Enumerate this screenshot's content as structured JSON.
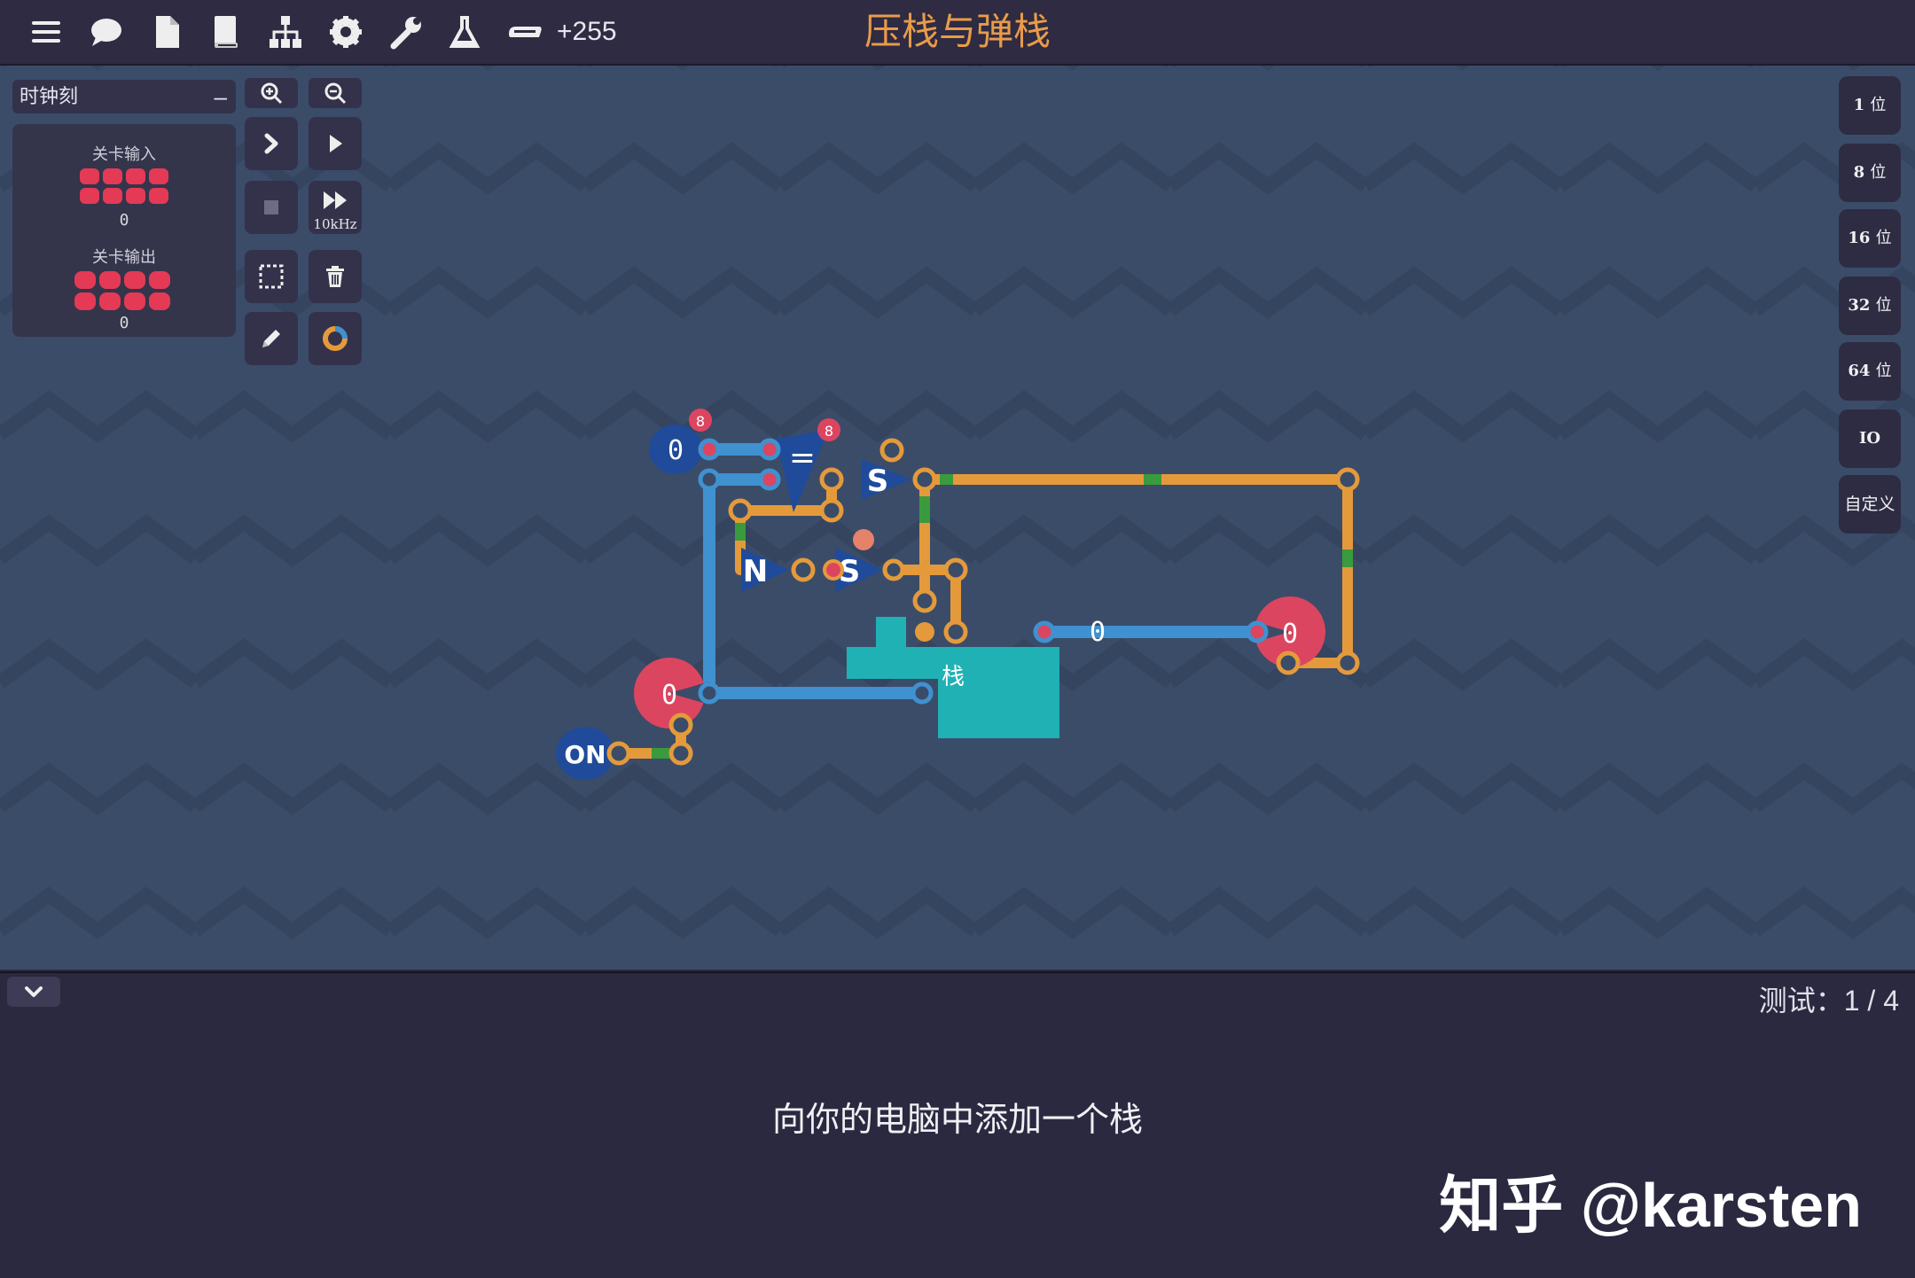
{
  "toolbar": {
    "icons": [
      "menu-icon",
      "chat-icon",
      "document-icon",
      "book-icon",
      "hierarchy-icon",
      "gear-icon",
      "wrench-icon",
      "flask-icon",
      "scanner-icon"
    ],
    "credits": "+255"
  },
  "title": "压栈与弹栈",
  "left_panel": {
    "clock_select": {
      "value": "时钟刻",
      "collapse": "–"
    },
    "level_input": {
      "label": "关卡输入",
      "value": "0"
    },
    "level_output": {
      "label": "关卡输出",
      "value": "0"
    },
    "frequency": "10kHz"
  },
  "bit_buttons": [
    {
      "num": "1",
      "unit": "位"
    },
    {
      "num": "8",
      "unit": "位"
    },
    {
      "num": "16",
      "unit": "位"
    },
    {
      "num": "32",
      "unit": "位"
    },
    {
      "num": "64",
      "unit": "位"
    },
    {
      "num": "IO",
      "unit": ""
    },
    {
      "num": "自定义",
      "unit": ""
    }
  ],
  "circuit": {
    "const_top": "0",
    "const_badge": "8",
    "eq_symbol": "=",
    "eq_badge": "8",
    "switch_top": "S",
    "not_gate": "N",
    "switch_mid": "S",
    "wire_value": "0",
    "stack_label": "栈",
    "output_left": "0",
    "output_right": "0",
    "on_label": "ON"
  },
  "colors": {
    "background": "#3b4c69",
    "wire_orange": "#e49a3b",
    "wire_blue": "#3f91d0",
    "component_blue": "#1f4b9a",
    "stack_teal": "#20b1b5",
    "output_red": "#dc4560",
    "title": "#e99b49"
  },
  "status": {
    "test": "测试：1 / 4"
  },
  "instruction": "向你的电脑中添加一个栈",
  "watermark": "知乎 @karsten"
}
